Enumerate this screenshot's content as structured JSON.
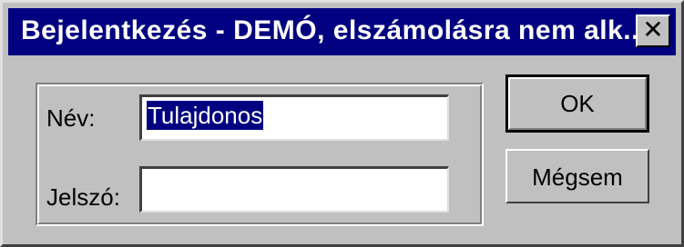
{
  "window": {
    "title": "Bejelentkezés -  DEMÓ, elszámolásra nem alk...",
    "close_symbol": "✕"
  },
  "form": {
    "name_label": "Név:",
    "name_value": "Tulajdonos",
    "password_label": "Jelszó:",
    "password_value": ""
  },
  "buttons": {
    "ok_label": "OK",
    "cancel_label": "Mégsem"
  },
  "colors": {
    "titlebar": "#000080",
    "window_face": "#c0c0c0",
    "selection": "#000080"
  }
}
